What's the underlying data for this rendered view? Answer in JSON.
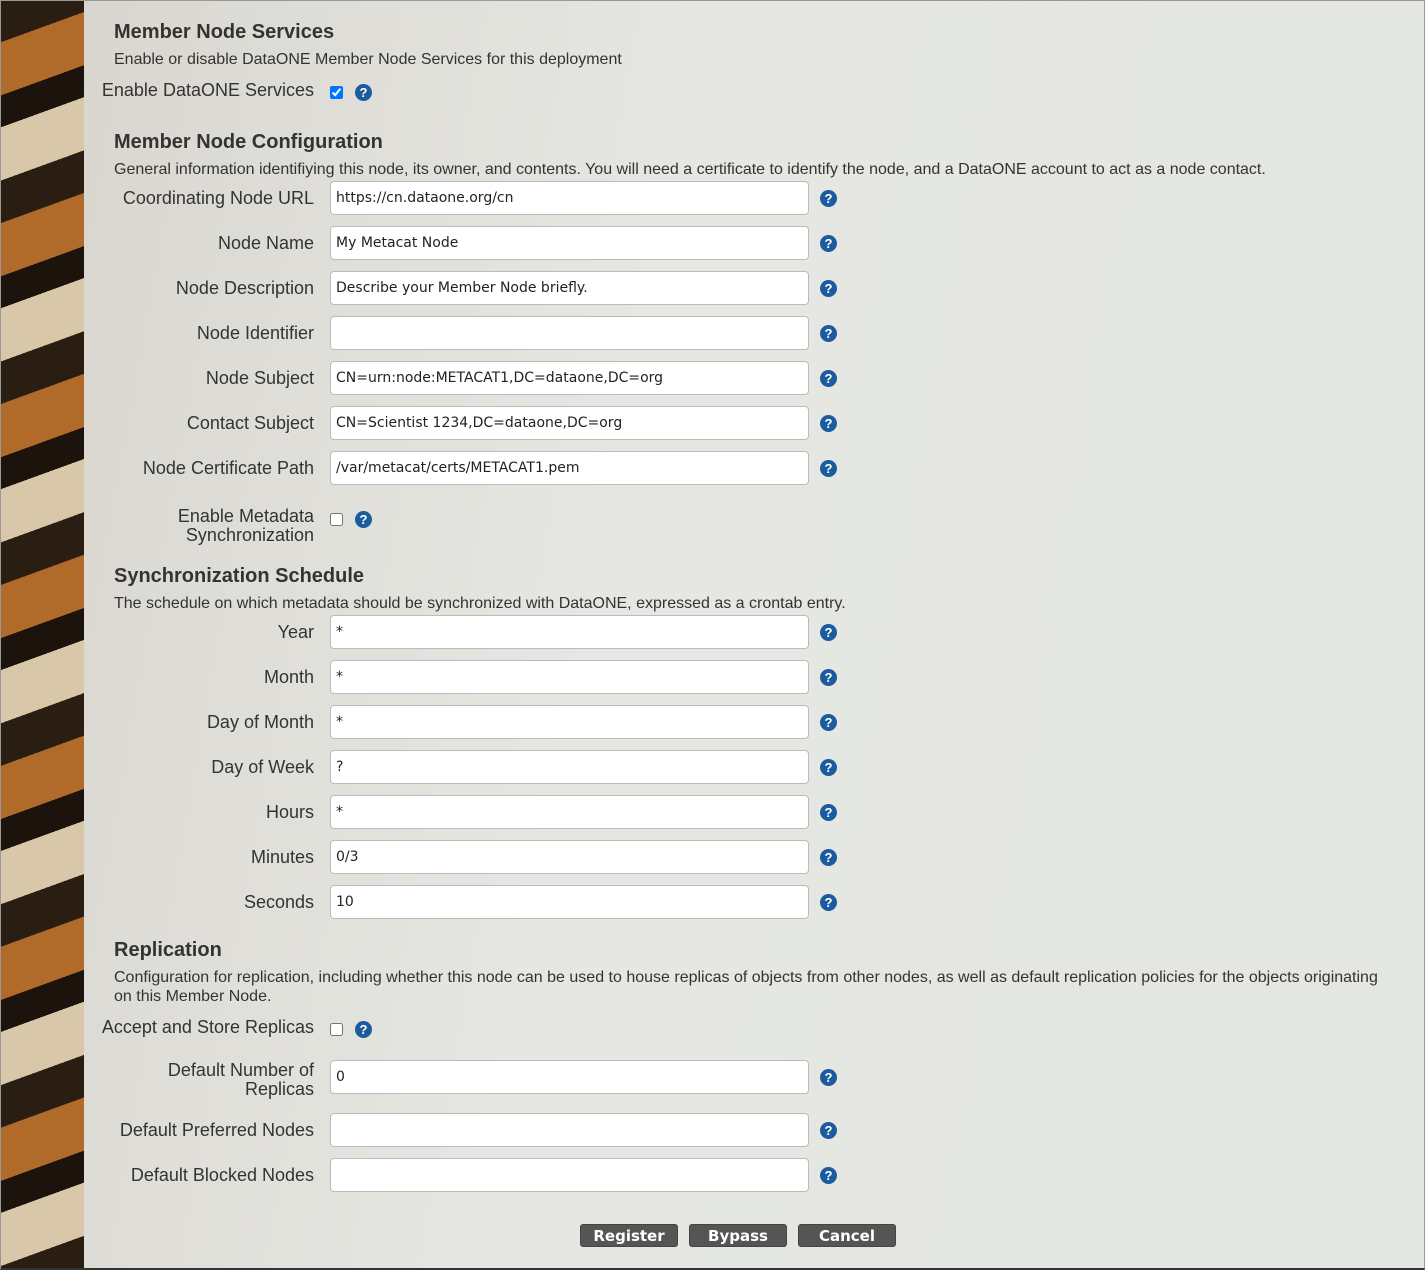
{
  "services": {
    "title": "Member Node Services",
    "desc": "Enable or disable DataONE Member Node Services for this deployment",
    "enable_label": "Enable DataONE Services",
    "enabled": true
  },
  "config": {
    "title": "Member Node Configuration",
    "desc": "General information identifiying this node, its owner, and contents. You will need a certificate to identify the node, and a DataONE account to act as a node contact.",
    "fields": [
      {
        "label": "Coordinating Node URL",
        "value": "https://cn.dataone.org/cn"
      },
      {
        "label": "Node Name",
        "value": "My Metacat Node"
      },
      {
        "label": "Node Description",
        "value": "Describe your Member Node briefly."
      },
      {
        "label": "Node Identifier",
        "value": ""
      },
      {
        "label": "Node Subject",
        "value": "CN=urn:node:METACAT1,DC=dataone,DC=org"
      },
      {
        "label": "Contact Subject",
        "value": "CN=Scientist 1234,DC=dataone,DC=org"
      },
      {
        "label": "Node Certificate Path",
        "value": "/var/metacat/certs/METACAT1.pem"
      }
    ],
    "sync_label": "Enable Metadata Synchronization",
    "sync_enabled": false
  },
  "schedule": {
    "title": "Synchronization Schedule",
    "desc": "The schedule on which metadata should be synchronized with DataONE, expressed as a crontab entry.",
    "fields": [
      {
        "label": "Year",
        "value": "*"
      },
      {
        "label": "Month",
        "value": "*"
      },
      {
        "label": "Day of Month",
        "value": "*"
      },
      {
        "label": "Day of Week",
        "value": "?"
      },
      {
        "label": "Hours",
        "value": "*"
      },
      {
        "label": "Minutes",
        "value": "0/3"
      },
      {
        "label": "Seconds",
        "value": "10"
      }
    ]
  },
  "replication": {
    "title": "Replication",
    "desc": "Configuration for replication, including whether this node can be used to house replicas of objects from other nodes, as well as default replication policies for the objects originating on this Member Node.",
    "accept_label": "Accept and Store Replicas",
    "accept": false,
    "fields": [
      {
        "label": "Default Number of Replicas",
        "value": "0"
      },
      {
        "label": "Default Preferred Nodes",
        "value": ""
      },
      {
        "label": "Default Blocked Nodes",
        "value": ""
      }
    ]
  },
  "help_glyph": "?",
  "buttons": {
    "register": "Register",
    "bypass": "Bypass",
    "cancel": "Cancel"
  }
}
